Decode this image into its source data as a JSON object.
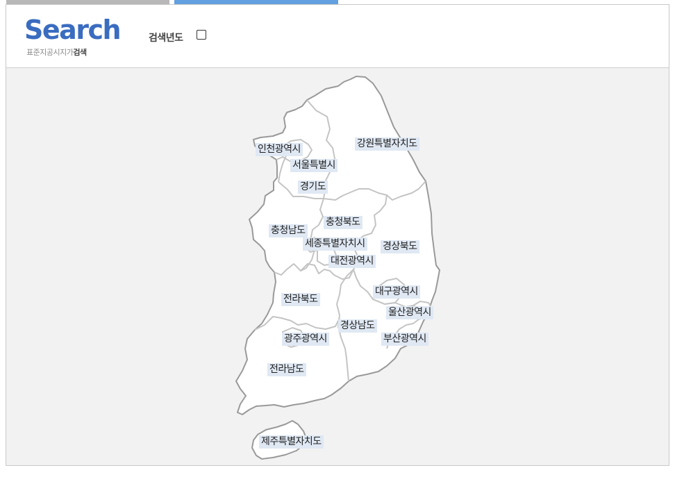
{
  "tabs": [
    {
      "state": "inactive"
    },
    {
      "state": "active"
    }
  ],
  "header": {
    "logo_text": "Search",
    "logo_sub_plain": "표준지공시지가",
    "logo_sub_bold": "검색",
    "year_label": "검색년도"
  },
  "regions": {
    "incheon": "인천광역시",
    "seoul": "서울특별시",
    "gyeonggi": "경기도",
    "gangwon": "강원특별자치도",
    "chungnam": "충청남도",
    "chungbuk": "충청북도",
    "sejong": "세종특별자치시",
    "daejeon": "대전광역시",
    "gyeongbuk": "경상북도",
    "daegu": "대구광역시",
    "jeonbuk": "전라북도",
    "ulsan": "울산광역시",
    "gyeongnam": "경상남도",
    "gwangju": "광주광역시",
    "busan": "부산광역시",
    "jeonnam": "전라남도",
    "jeju": "제주특별자치도"
  },
  "colors": {
    "active_tab": "#63a0e0",
    "inactive_tab": "#b8b8b8",
    "logo": "#3a6cc0",
    "label_bg": "#dfe8f3"
  }
}
